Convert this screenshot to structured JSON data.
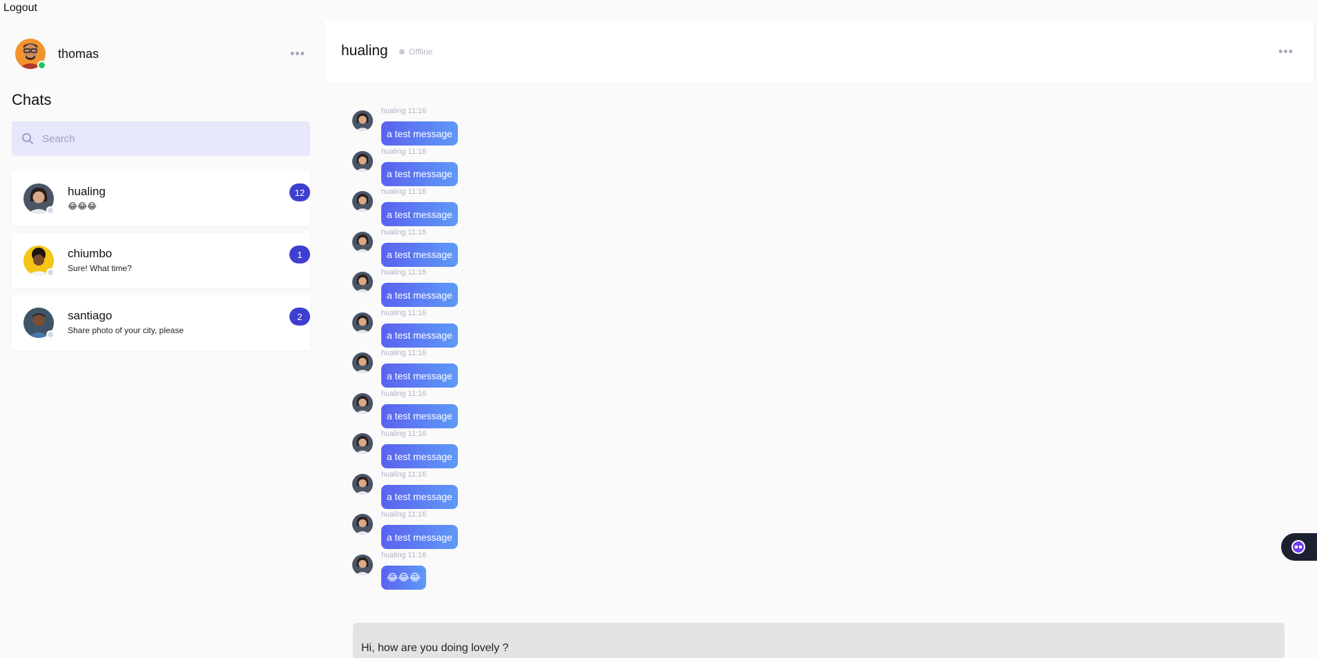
{
  "logout_label": "Logout",
  "current_user": {
    "name": "thomas",
    "status_color": "#22c55e",
    "menu_icon": "more-horizontal-icon"
  },
  "sidebar": {
    "title": "Chats",
    "search": {
      "placeholder": "Search",
      "value": ""
    },
    "chats": [
      {
        "name": "hualing",
        "preview": "😂😂😂",
        "unread": "12",
        "status_color": "#d6d9e6"
      },
      {
        "name": "chiumbo",
        "preview": "Sure! What time?",
        "unread": "1",
        "status_color": "#d6d9e6"
      },
      {
        "name": "santiago",
        "preview": "Share photo of your city, please",
        "unread": "2",
        "status_color": "#d6d9e6"
      }
    ]
  },
  "conversation": {
    "name": "hualing",
    "status": "Offline",
    "menu_icon": "more-horizontal-icon",
    "messages": [
      {
        "meta": "hualing 11:16",
        "text": "a test message"
      },
      {
        "meta": "hualing 11:16",
        "text": "a test message"
      },
      {
        "meta": "hualing 11:16",
        "text": "a test message"
      },
      {
        "meta": "hualing 11:16",
        "text": "a test message"
      },
      {
        "meta": "hualing 11:16",
        "text": "a test message"
      },
      {
        "meta": "hualing 11:16",
        "text": "a test message"
      },
      {
        "meta": "hualing 11:16",
        "text": "a test message"
      },
      {
        "meta": "hualing 11:16",
        "text": "a test message"
      },
      {
        "meta": "hualing 11:16",
        "text": "a test message"
      },
      {
        "meta": "hualing 11:16",
        "text": "a test message"
      },
      {
        "meta": "hualing 11:16",
        "text": "a test message"
      },
      {
        "meta": "hualing 11:16",
        "text": "😂😂😂"
      }
    ]
  },
  "composer": {
    "value": "Hi, how are you doing lovely ?"
  },
  "colors": {
    "accent": "#3f3fcf",
    "bubble_start": "#5a62ef",
    "bubble_end": "#5f9af7",
    "search_bg": "#e6e7fa"
  }
}
